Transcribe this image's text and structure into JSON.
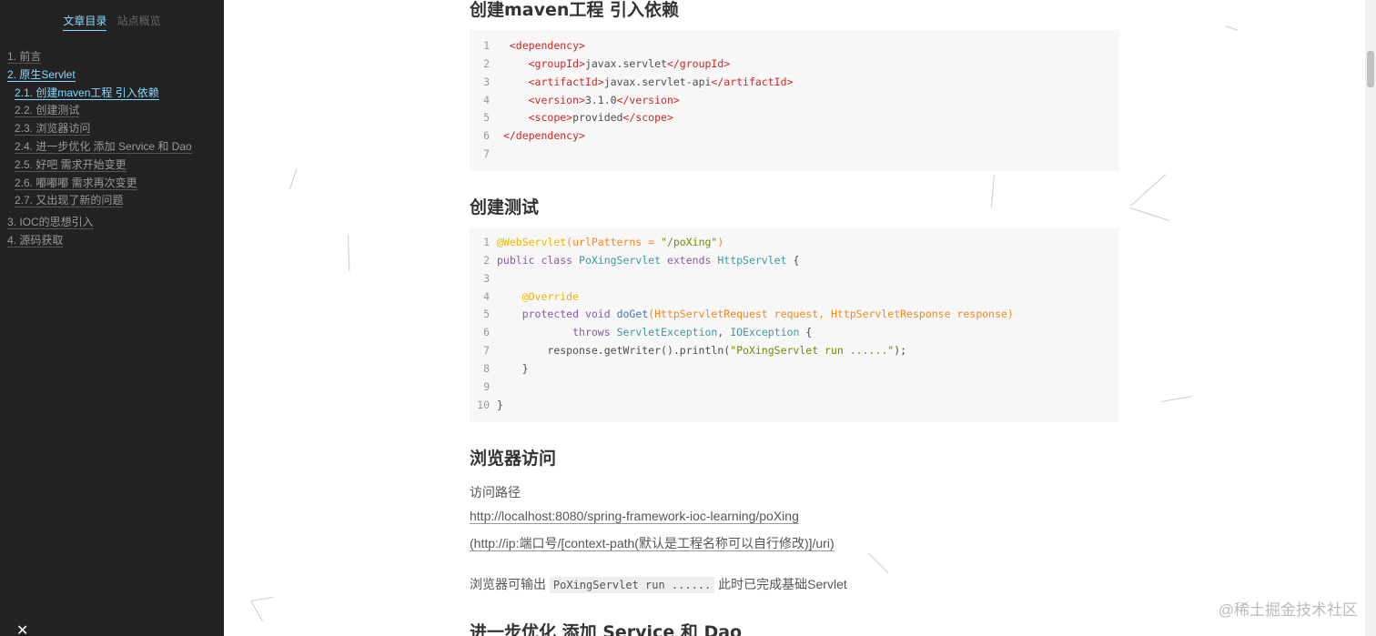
{
  "sidebar": {
    "tabs": {
      "toc": "文章目录",
      "overview": "站点概览"
    },
    "items": [
      {
        "label": "1. 前言",
        "level": 1,
        "active": false
      },
      {
        "label": "2. 原生Servlet",
        "level": 1,
        "active": true
      },
      {
        "label": "2.1. 创建maven工程 引入依赖",
        "level": 2,
        "active": true
      },
      {
        "label": "2.2. 创建测试",
        "level": 2,
        "active": false
      },
      {
        "label": "2.3. 浏览器访问",
        "level": 2,
        "active": false
      },
      {
        "label": "2.4. 进一步优化 添加 Service 和 Dao",
        "level": 2,
        "active": false
      },
      {
        "label": "2.5. 好吧 需求开始变更",
        "level": 2,
        "active": false
      },
      {
        "label": "2.6. 嘟嘟嘟 需求再次变更",
        "level": 2,
        "active": false
      },
      {
        "label": "2.7. 又出现了新的问题",
        "level": 2,
        "active": false
      },
      {
        "label": "3. IOC的思想引入",
        "level": 1,
        "active": false
      },
      {
        "label": "4. 源码获取",
        "level": 1,
        "active": false
      }
    ],
    "close_icon": "close-icon"
  },
  "content": {
    "heading_maven": "创建maven工程 引入依赖",
    "heading_test": "创建测试",
    "heading_browser": "浏览器访问",
    "heading_next": "进一步优化 添加 Service 和 Dao",
    "path_label": "访问路径",
    "url": "http://localhost:8080/spring-framework-ioc-learning/poXing",
    "url_pattern": "(http://ip:端口号/[context-path(默认是工程名称可以自行修改)]/uri)",
    "output_prefix": "浏览器可输出",
    "output_code": "PoXingServlet run ......",
    "output_suffix": "此时已完成基础Servlet"
  },
  "code1": [
    {
      "n": "1",
      "indent": "  ",
      "parts": [
        [
          "tag",
          "<dependency>"
        ]
      ]
    },
    {
      "n": "2",
      "indent": "     ",
      "parts": [
        [
          "tag",
          "<groupId>"
        ],
        [
          "plain",
          "javax.servlet"
        ],
        [
          "tag",
          "</groupId>"
        ]
      ]
    },
    {
      "n": "3",
      "indent": "     ",
      "parts": [
        [
          "tag",
          "<artifactId>"
        ],
        [
          "plain",
          "javax.servlet-api"
        ],
        [
          "tag",
          "</artifactId>"
        ]
      ]
    },
    {
      "n": "4",
      "indent": "     ",
      "parts": [
        [
          "tag",
          "<version>"
        ],
        [
          "plain",
          "3.1.0"
        ],
        [
          "tag",
          "</version>"
        ]
      ]
    },
    {
      "n": "5",
      "indent": "     ",
      "parts": [
        [
          "tag",
          "<scope>"
        ],
        [
          "plain",
          "provided"
        ],
        [
          "tag",
          "</scope>"
        ]
      ]
    },
    {
      "n": "6",
      "indent": " ",
      "parts": [
        [
          "tag",
          "</dependency>"
        ]
      ]
    },
    {
      "n": "7",
      "indent": "",
      "parts": []
    }
  ],
  "code2": [
    {
      "n": "1",
      "indent": "",
      "parts": [
        [
          "anno",
          "@WebServlet"
        ],
        [
          "par",
          "(urlPatterns = "
        ],
        [
          "str",
          "\"/poXing\""
        ],
        [
          "par",
          ")"
        ]
      ]
    },
    {
      "n": "2",
      "indent": "",
      "parts": [
        [
          "kw",
          "public class "
        ],
        [
          "cls",
          "PoXingServlet "
        ],
        [
          "kw",
          "extends "
        ],
        [
          "cls",
          "HttpServlet "
        ],
        [
          "plain",
          "{"
        ]
      ]
    },
    {
      "n": "3",
      "indent": "",
      "parts": []
    },
    {
      "n": "4",
      "indent": "    ",
      "parts": [
        [
          "anno",
          "@Override"
        ]
      ]
    },
    {
      "n": "5",
      "indent": "    ",
      "parts": [
        [
          "kw",
          "protected void "
        ],
        [
          "fn",
          "doGet"
        ],
        [
          "par",
          "(HttpServletRequest request, HttpServletResponse response)"
        ]
      ]
    },
    {
      "n": "6",
      "indent": "            ",
      "parts": [
        [
          "kw",
          "throws "
        ],
        [
          "cls",
          "ServletException"
        ],
        [
          "plain",
          ", "
        ],
        [
          "cls",
          "IOException "
        ],
        [
          "plain",
          "{"
        ]
      ]
    },
    {
      "n": "7",
      "indent": "        ",
      "parts": [
        [
          "plain",
          "response.getWriter().println("
        ],
        [
          "str",
          "\"PoXingServlet run ......\""
        ],
        [
          "plain",
          ");"
        ]
      ]
    },
    {
      "n": "8",
      "indent": "    ",
      "parts": [
        [
          "plain",
          "}"
        ]
      ]
    },
    {
      "n": "9",
      "indent": "",
      "parts": []
    },
    {
      "n": "10",
      "indent": "",
      "parts": [
        [
          "plain",
          "}"
        ]
      ]
    }
  ],
  "watermark": "@稀土掘金技术社区"
}
